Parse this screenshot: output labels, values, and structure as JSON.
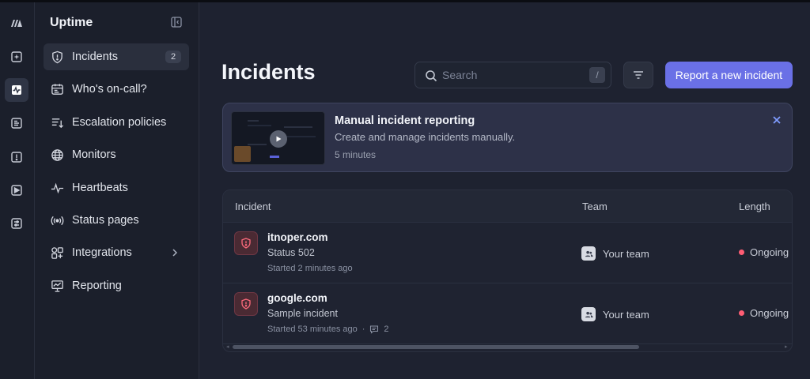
{
  "app": {
    "title": "Uptime"
  },
  "colors": {
    "accent": "#6a70e6",
    "danger": "#ff5d74",
    "background": "#1e2230",
    "sidebar": "#1b1f2b"
  },
  "rail": {
    "icons": [
      "logo-icon",
      "sparkle-icon",
      "activity-icon",
      "logs-icon",
      "alert-icon",
      "play-icon",
      "settings-icon"
    ],
    "active": "activity-icon"
  },
  "sidebar": {
    "items": [
      {
        "label": "Incidents",
        "icon": "shield-alert-icon",
        "badge": "2",
        "active": true
      },
      {
        "label": "Who's on-call?",
        "icon": "calendar-icon"
      },
      {
        "label": "Escalation policies",
        "icon": "list-sort-icon"
      },
      {
        "label": "Monitors",
        "icon": "globe-icon"
      },
      {
        "label": "Heartbeats",
        "icon": "pulse-icon"
      },
      {
        "label": "Status pages",
        "icon": "broadcast-icon"
      },
      {
        "label": "Integrations",
        "icon": "integrations-icon",
        "has_chevron": true
      },
      {
        "label": "Reporting",
        "icon": "chart-icon"
      }
    ]
  },
  "header": {
    "title": "Incidents",
    "search_placeholder": "Search",
    "search_shortcut": "/",
    "primary_action": "Report a new incident"
  },
  "banner": {
    "title": "Manual incident reporting",
    "description": "Create and manage incidents manually.",
    "duration": "5 minutes"
  },
  "table": {
    "columns": [
      "Incident",
      "Team",
      "Length"
    ],
    "rows": [
      {
        "name": "itnoper.com",
        "description": "Status 502",
        "started": "Started 2 minutes ago",
        "comments": "",
        "team": "Your team",
        "length": "Ongoing"
      },
      {
        "name": "google.com",
        "description": "Sample incident",
        "started": "Started 53 minutes ago",
        "comments": "2",
        "team": "Your team",
        "length": "Ongoing"
      }
    ]
  }
}
